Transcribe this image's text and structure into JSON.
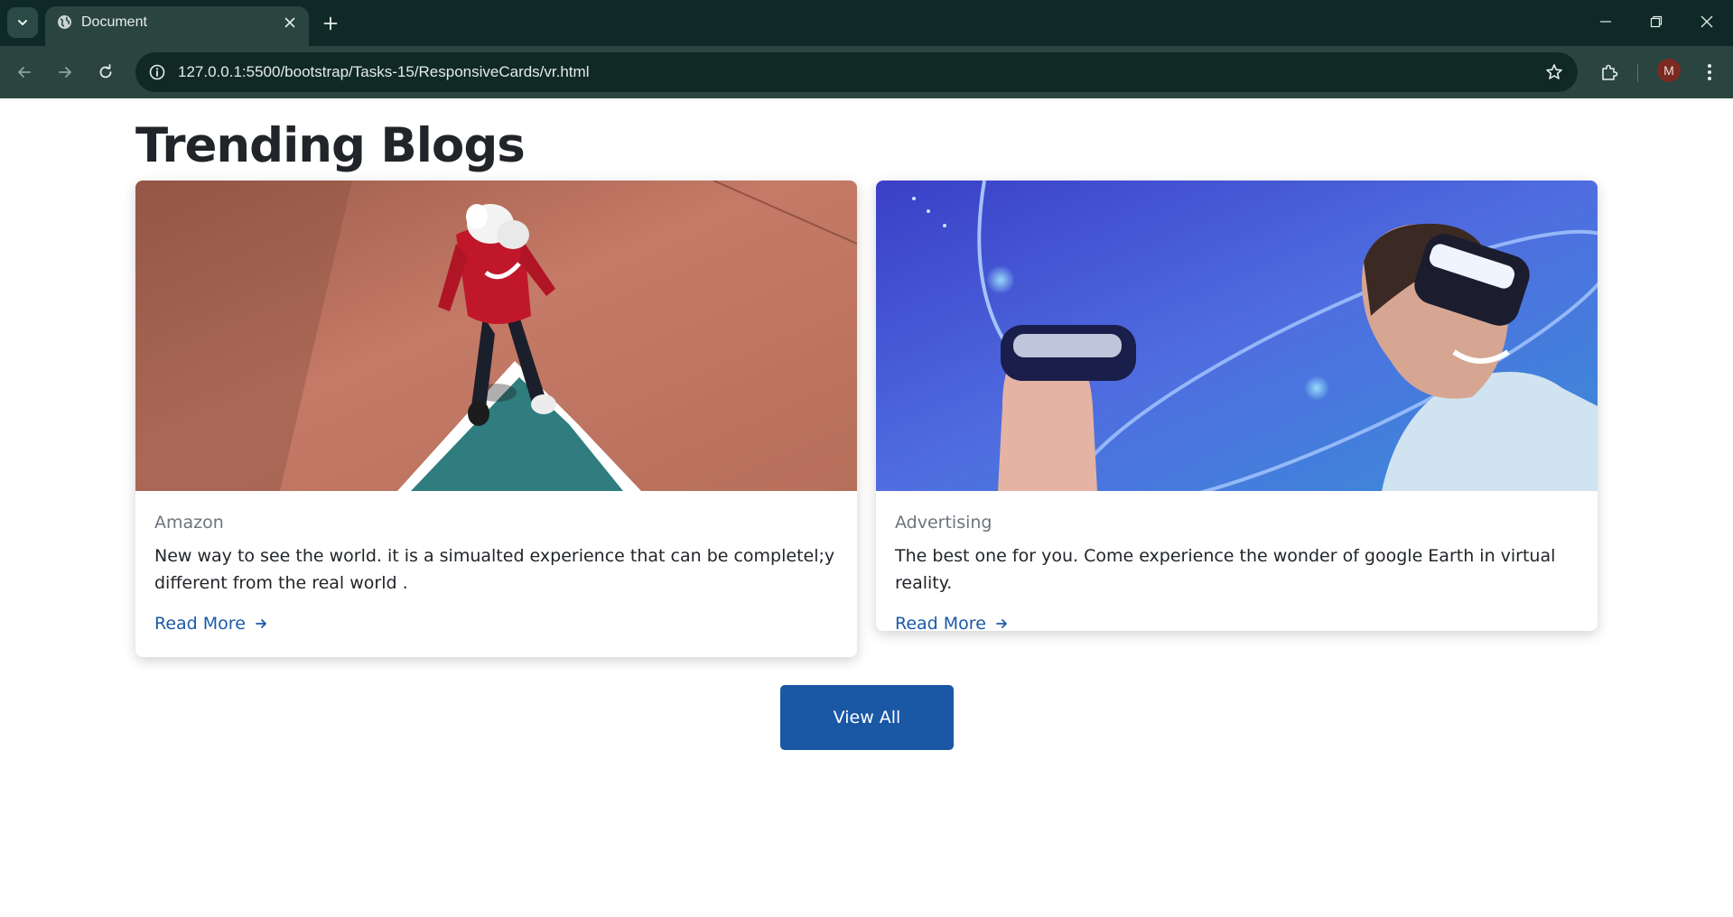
{
  "browser": {
    "tab_title": "Document",
    "url": "127.0.0.1:5500/bootstrap/Tasks-15/ResponsiveCards/vr.html",
    "profile_initial": "M"
  },
  "page": {
    "heading": "Trending Blogs",
    "cards": [
      {
        "subtitle": "Amazon",
        "text": "New way to see the world. it is a simualted experience that can be completel;y different from the real world .",
        "link_label": "Read More",
        "image": "vr-headset-red-hoodie-court"
      },
      {
        "subtitle": "Advertising",
        "text": "The best one for you. Come experience the wonder of google Earth in virtual reality.",
        "link_label": "Read More",
        "image": "vr-headsets-blue-glow"
      }
    ],
    "view_all_label": "View All"
  },
  "colors": {
    "tabstrip_bg": "#0f2a26",
    "toolbar_bg": "#2a4540",
    "link": "#1a5aa8",
    "primary_button": "#1a57a5",
    "subtitle": "#6c757d"
  }
}
